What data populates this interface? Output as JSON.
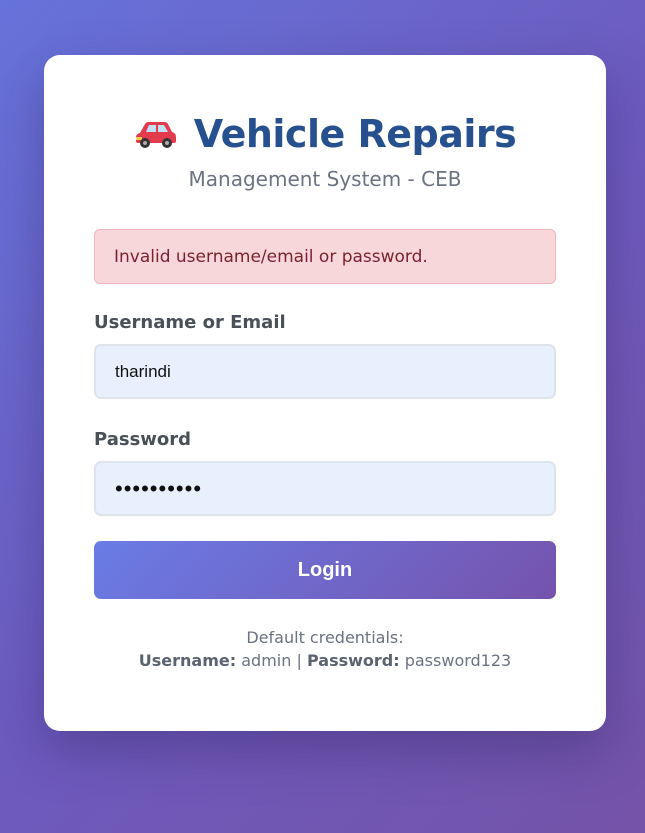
{
  "header": {
    "icon": "car-icon",
    "title": "Vehicle Repairs",
    "subtitle": "Management System - CEB"
  },
  "alert": {
    "message": "Invalid username/email or password."
  },
  "form": {
    "username_label": "Username or Email",
    "username_value": "tharindi",
    "password_label": "Password",
    "password_value": "••••••••••",
    "login_label": "Login"
  },
  "defaults": {
    "heading": "Default credentials:",
    "username_label": "Username:",
    "username_value": "admin",
    "separator": "|",
    "password_label": "Password:",
    "password_value": "password123"
  },
  "colors": {
    "title": "#27508f",
    "alert_bg": "#f8d7da",
    "alert_text": "#7a2330",
    "button_start": "#6a7ce6",
    "button_end": "#7553ad"
  }
}
